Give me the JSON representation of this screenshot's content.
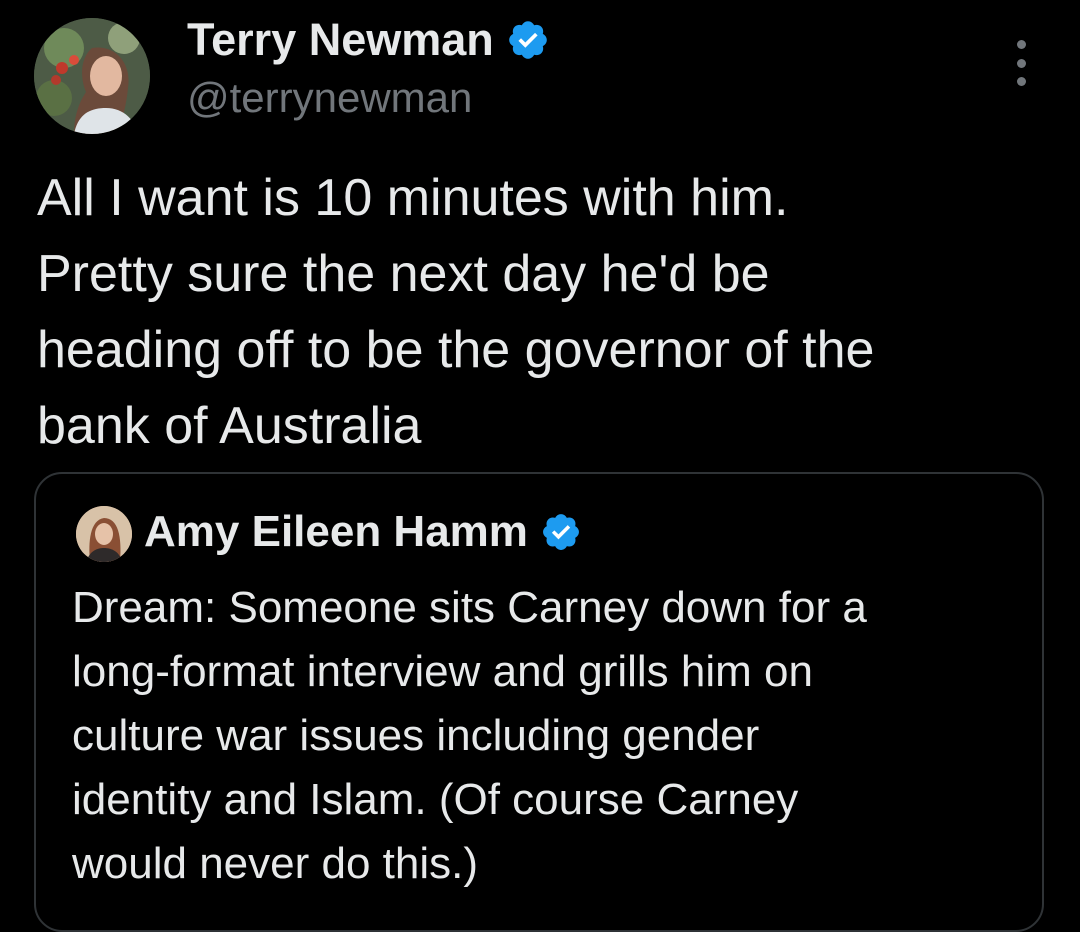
{
  "tweet": {
    "author": {
      "name": "Terry Newman",
      "handle": "@terrynewman",
      "verified": true
    },
    "text": "All I want is 10 minutes with him.\nPretty sure the next day he'd be\nheading off to be the governor of the\nbank of Australia"
  },
  "quoted_tweet": {
    "author": {
      "name": "Amy Eileen Hamm",
      "verified": true
    },
    "text": "Dream: Someone sits Carney down for a\nlong-format interview and grills him on\nculture war issues including gender\nidentity and Islam. (Of course Carney\nwould never do this.)"
  },
  "colors": {
    "background": "#000000",
    "text_primary": "#e7e9ea",
    "text_secondary": "#71767b",
    "verified_badge": "#1d9bf0",
    "card_border": "#2f3336"
  },
  "icons": {
    "verified": "verified-badge-icon",
    "more": "more-options-icon"
  }
}
